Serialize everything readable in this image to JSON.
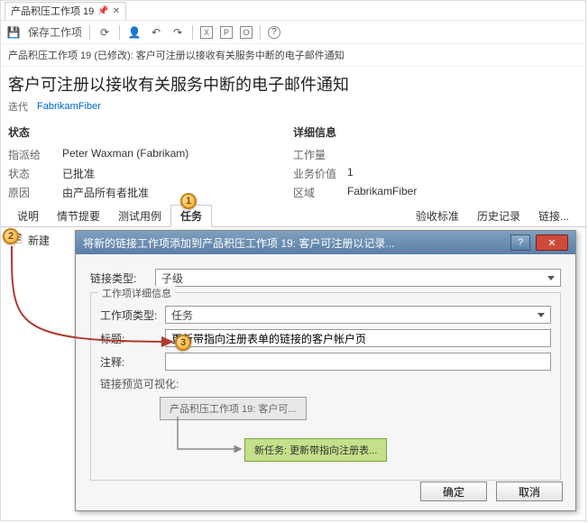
{
  "doc_tab": {
    "title": "产品积压工作项 19"
  },
  "toolbar": {
    "save_label": "保存工作项"
  },
  "crumb": "产品积压工作项 19 (已修改): 客户可注册以接收有关服务中断的电子邮件通知",
  "title": "客户可注册以接收有关服务中断的电子邮件通知",
  "iteration": {
    "label": "迭代",
    "value": "FabrikamFiber"
  },
  "left_col": {
    "heading": "状态",
    "rows": [
      {
        "label": "指派给",
        "value": "Peter Waxman (Fabrikam)"
      },
      {
        "label": "状态",
        "value": "已批准"
      },
      {
        "label": "原因",
        "value": "由产品所有者批准"
      }
    ]
  },
  "right_col": {
    "heading": "详细信息",
    "rows": [
      {
        "label": "工作量",
        "value": ""
      },
      {
        "label": "业务价值",
        "value": "1"
      },
      {
        "label": "区域",
        "value": "FabrikamFiber"
      }
    ]
  },
  "itabs": {
    "left": [
      "说明",
      "情节提要",
      "测试用例",
      "任务"
    ],
    "active": "任务",
    "right": [
      "验收标准",
      "历史记录",
      "链接..."
    ]
  },
  "new_button": "新建",
  "dialog": {
    "title": "将新的链接工作项添加到产品积压工作项 19: 客户可注册以记录...",
    "link_type_label": "链接类型:",
    "link_type_value": "子级",
    "group_title": "工作项详细信息",
    "wit_label": "工作项类型:",
    "wit_value": "任务",
    "title_label": "标题:",
    "title_value": "更新带指向注册表单的链接的客户帐户页",
    "comment_label": "注释:",
    "comment_value": "",
    "preview_label": "链接预览可视化:",
    "preview_parent": "产品积压工作项 19: 客户可...",
    "preview_child": "新任务: 更新带指向注册表...",
    "ok": "确定",
    "cancel": "取消"
  },
  "annotations": [
    "1",
    "2",
    "3"
  ]
}
